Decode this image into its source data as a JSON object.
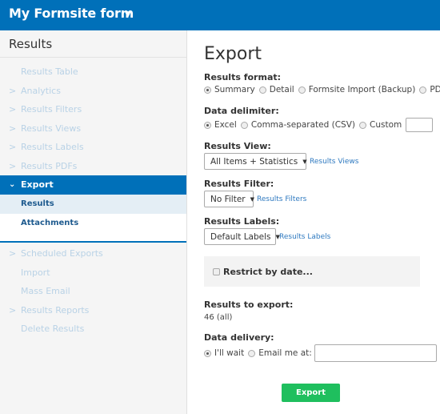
{
  "header": {
    "title": "My Formsite form",
    "caret_icon": "caret-down-icon"
  },
  "sidebar": {
    "heading": "Results",
    "items_top": [
      {
        "label": "Results Table",
        "has_chevron": false
      },
      {
        "label": "Analytics",
        "has_chevron": true
      },
      {
        "label": "Results Filters",
        "has_chevron": true
      },
      {
        "label": "Results Views",
        "has_chevron": true
      },
      {
        "label": "Results Labels",
        "has_chevron": true
      },
      {
        "label": "Results PDFs",
        "has_chevron": true
      }
    ],
    "active": {
      "label": "Export",
      "sub_items": [
        "Results",
        "Attachments"
      ],
      "selected_sub": "Results"
    },
    "items_bottom": [
      {
        "label": "Scheduled Exports",
        "has_chevron": true
      },
      {
        "label": "Import",
        "has_chevron": false
      },
      {
        "label": "Mass Email",
        "has_chevron": false
      },
      {
        "label": "Results Reports",
        "has_chevron": true
      },
      {
        "label": "Delete Results",
        "has_chevron": false
      }
    ]
  },
  "main": {
    "title": "Export",
    "results_format": {
      "label": "Results format:",
      "options": [
        "Summary",
        "Detail",
        "Formsite Import (Backup)",
        "PDF"
      ],
      "selected": "Summary"
    },
    "data_delimiter": {
      "label": "Data delimiter:",
      "options": [
        "Excel",
        "Comma-separated (CSV)",
        "Custom"
      ],
      "selected": "Excel",
      "custom_value": ""
    },
    "results_view": {
      "label": "Results View:",
      "value": "All Items + Statistics",
      "link": "Results Views"
    },
    "results_filter": {
      "label": "Results Filter:",
      "value": "No Filter",
      "link": "Results Filters"
    },
    "results_labels": {
      "label": "Results Labels:",
      "value": "Default Labels",
      "link": "Results Labels"
    },
    "restrict_by_date": {
      "label": "Restrict by date...",
      "checked": false
    },
    "results_to_export": {
      "label": "Results to export:",
      "value": "46 (all)"
    },
    "data_delivery": {
      "label": "Data delivery:",
      "options": [
        "I'll wait",
        "Email me at:"
      ],
      "selected": "I'll wait",
      "email_value": ""
    },
    "export_button": "Export"
  },
  "colors": {
    "brand_blue": "#0070b9",
    "export_green": "#1fbf5e",
    "link_blue": "#2f7ac0"
  }
}
